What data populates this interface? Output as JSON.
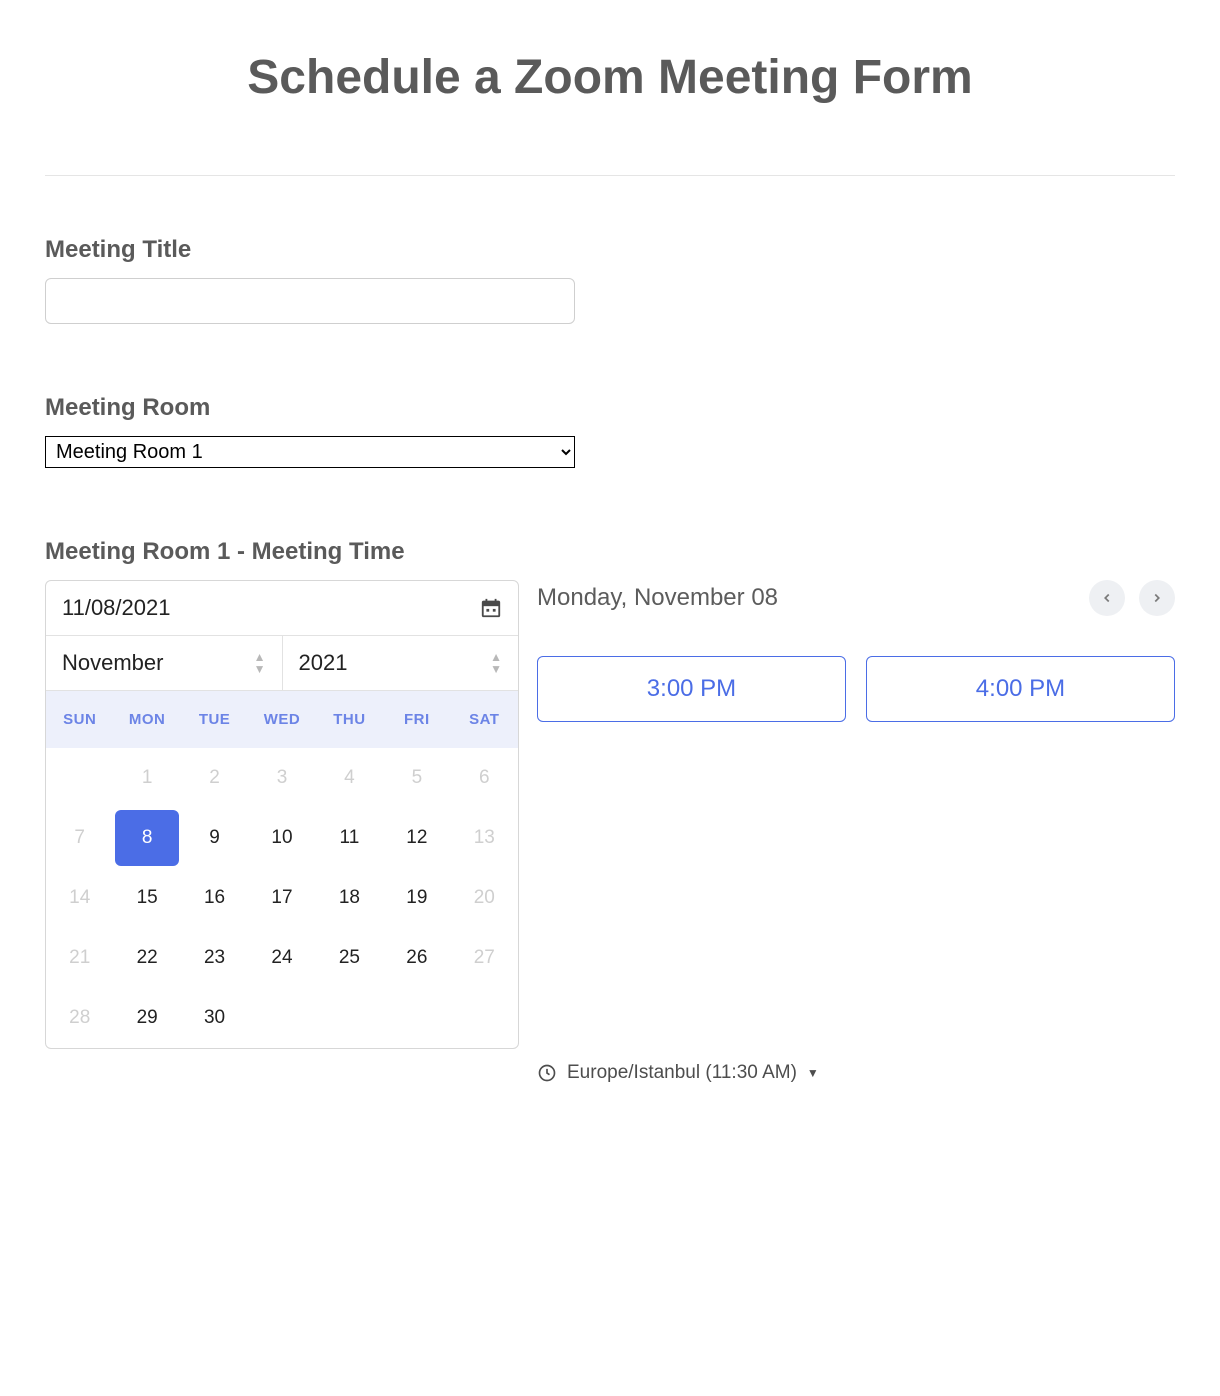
{
  "page_title": "Schedule a Zoom Meeting Form",
  "fields": {
    "meeting_title_label": "Meeting Title",
    "meeting_title_value": "",
    "meeting_room_label": "Meeting Room",
    "meeting_room_selected": "Meeting Room 1",
    "meeting_time_label": "Meeting Room 1 - Meeting Time"
  },
  "calendar": {
    "date_value": "11/08/2021",
    "month_label": "November",
    "year_label": "2021",
    "dow": [
      "SUN",
      "MON",
      "TUE",
      "WED",
      "THU",
      "FRI",
      "SAT"
    ],
    "weeks": [
      [
        {
          "n": "",
          "d": true
        },
        {
          "n": "1",
          "d": true
        },
        {
          "n": "2",
          "d": true
        },
        {
          "n": "3",
          "d": true
        },
        {
          "n": "4",
          "d": true
        },
        {
          "n": "5",
          "d": true
        },
        {
          "n": "6",
          "d": true
        }
      ],
      [
        {
          "n": "7",
          "d": true
        },
        {
          "n": "8",
          "sel": true
        },
        {
          "n": "9"
        },
        {
          "n": "10"
        },
        {
          "n": "11"
        },
        {
          "n": "12"
        },
        {
          "n": "13",
          "d": true
        }
      ],
      [
        {
          "n": "14",
          "d": true
        },
        {
          "n": "15"
        },
        {
          "n": "16"
        },
        {
          "n": "17"
        },
        {
          "n": "18"
        },
        {
          "n": "19"
        },
        {
          "n": "20",
          "d": true
        }
      ],
      [
        {
          "n": "21",
          "d": true
        },
        {
          "n": "22"
        },
        {
          "n": "23"
        },
        {
          "n": "24"
        },
        {
          "n": "25"
        },
        {
          "n": "26"
        },
        {
          "n": "27",
          "d": true
        }
      ],
      [
        {
          "n": "28",
          "d": true
        },
        {
          "n": "29"
        },
        {
          "n": "30"
        },
        {
          "n": "",
          "d": true
        },
        {
          "n": "",
          "d": true
        },
        {
          "n": "",
          "d": true
        },
        {
          "n": "",
          "d": true
        }
      ]
    ]
  },
  "time_panel": {
    "display_date": "Monday, November 08",
    "slots": [
      "3:00 PM",
      "4:00 PM"
    ],
    "timezone_text": "Europe/Istanbul (11:30 AM)"
  }
}
